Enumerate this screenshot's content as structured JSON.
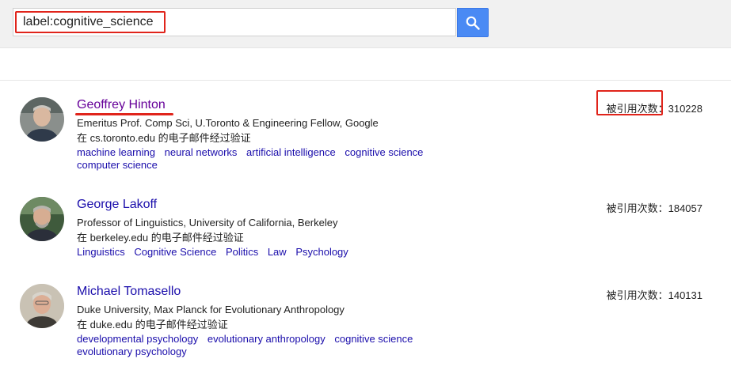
{
  "search": {
    "query": "label:cognitive_science"
  },
  "colors": {
    "link": "#1a0dab",
    "visited_link": "#660099",
    "highlight_red": "#e0241b",
    "search_button": "#4a8af4"
  },
  "profiles": [
    {
      "name": "Geoffrey Hinton",
      "affiliation": "Emeritus Prof. Comp Sci, U.Toronto & Engineering Fellow, Google",
      "email": "在 cs.toronto.edu 的电子邮件经过验证",
      "cited_label": "被引用次数：",
      "cited_count": "310228",
      "tags": [
        "machine learning",
        "neural networks",
        "artificial intelligence",
        "cognitive science",
        "computer science"
      ]
    },
    {
      "name": "George Lakoff",
      "affiliation": "Professor of Linguistics, University of California, Berkeley",
      "email": "在 berkeley.edu 的电子邮件经过验证",
      "cited_label": "被引用次数：",
      "cited_count": "184057",
      "tags": [
        "Linguistics",
        "Cognitive Science",
        "Politics",
        "Law",
        "Psychology"
      ]
    },
    {
      "name": "Michael Tomasello",
      "affiliation": "Duke University, Max Planck for Evolutionary Anthropology",
      "email": "在 duke.edu 的电子邮件经过验证",
      "cited_label": "被引用次数：",
      "cited_count": "140131",
      "tags": [
        "developmental psychology",
        "evolutionary anthropology",
        "cognitive science",
        "evolutionary psychology"
      ]
    }
  ]
}
